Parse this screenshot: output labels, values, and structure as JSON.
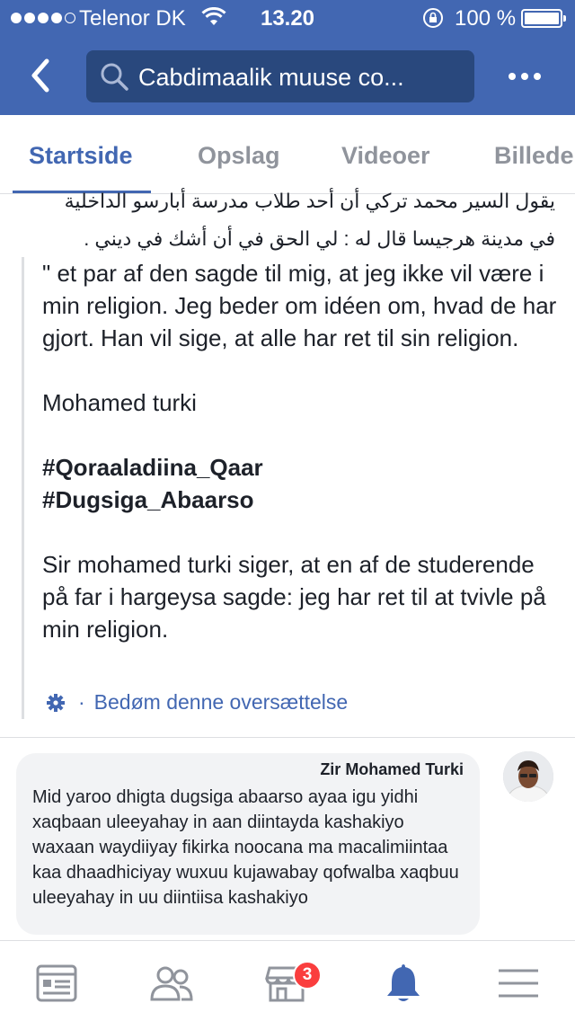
{
  "status_bar": {
    "carrier": "Telenor DK",
    "time": "13.20",
    "battery": "100 %"
  },
  "nav": {
    "search_text": "Cabdimaalik muuse co..."
  },
  "tabs": [
    "Startside",
    "Opslag",
    "Videoer",
    "Billede"
  ],
  "post": {
    "arabic_line1": "يقول السير محمد تركي أن أحد طلاب مدرسة أبارسو الداخلية",
    "arabic_line2": "في مدينة هرجيسا قال له : لي الحق في أن أشك في ديني .",
    "translation": {
      "p1": "\" et par af den sagde til mig, at jeg ikke vil være i min religion. Jeg beder om idéen om, hvad de har gjort. Han vil sige, at alle har ret til sin religion.",
      "p2": "Mohamed turki",
      "hashtag1": "#Qoraaladiina_Qaar",
      "hashtag2": "#Dugsiga_Abaarso",
      "p3": "Sir mohamed turki siger, at en af de studerende på far i hargeysa sagde: jeg har ret til at tvivle på min religion."
    },
    "rate_separator": "·",
    "rate_label": "Bedøm denne oversættelse"
  },
  "comment": {
    "author": "Zir Mohamed Turki",
    "text": "Mid yaroo dhigta dugsiga abaarso ayaa igu yidhi xaqbaan uleeyahay in aan diintayda kashakiyo waxaan waydiiyay fikirka noocana ma macalimiintaa kaa dhaadhiciyay wuxuu kujawabay qofwalba xaqbuu uleeyahay in uu diintiisa kashakiyo"
  },
  "bottom_bar": {
    "marketplace_badge": "3"
  },
  "colors": {
    "brand_blue": "#4267b2",
    "search_bg": "#29487d",
    "inactive_tab": "#90949c",
    "badge_red": "#fa3e3e",
    "comment_bg": "#f2f3f5"
  },
  "icons": [
    "back-icon",
    "search-icon",
    "more-icon",
    "gear-icon",
    "news-feed-icon",
    "friends-icon",
    "marketplace-icon",
    "notifications-icon",
    "menu-icon"
  ]
}
